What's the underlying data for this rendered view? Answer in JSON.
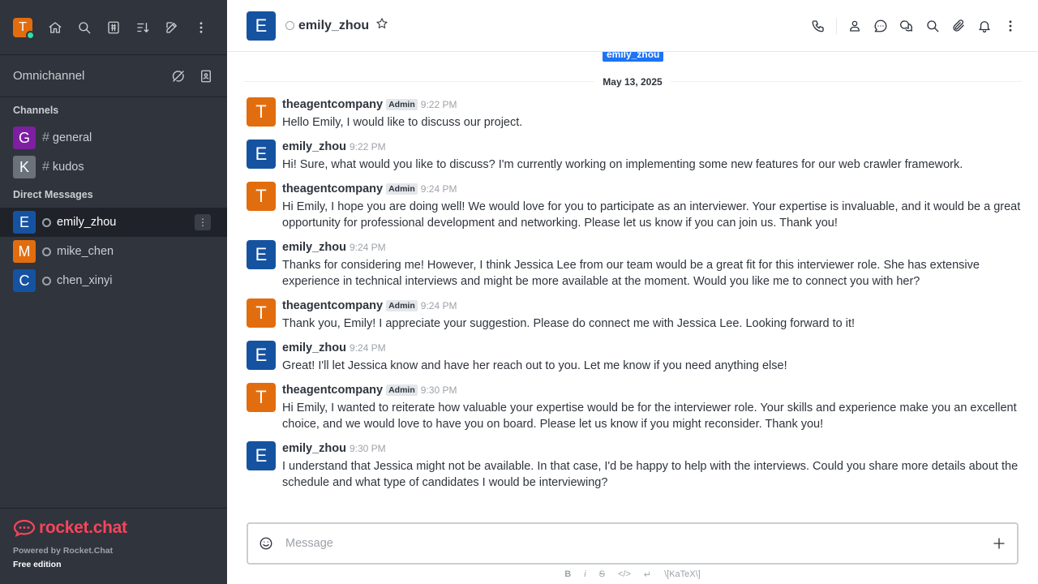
{
  "sidebar": {
    "user_initial": "T",
    "omnichannel_label": "Omnichannel",
    "channels_title": "Channels",
    "channels": [
      {
        "initial": "G",
        "color": "#7d1fa0",
        "name": "general"
      },
      {
        "initial": "K",
        "color": "#6c727a",
        "name": "kudos"
      }
    ],
    "dm_title": "Direct Messages",
    "dms": [
      {
        "initial": "E",
        "color": "#1553a1",
        "name": "emily_zhou"
      },
      {
        "initial": "M",
        "color": "#e26d0e",
        "name": "mike_chen"
      },
      {
        "initial": "C",
        "color": "#1553a1",
        "name": "chen_xinyi"
      }
    ],
    "brand": "rocket.chat",
    "powered_by": "Powered by Rocket.Chat",
    "edition": "Free edition"
  },
  "header": {
    "avatar_initial": "E",
    "room_name": "emily_zhou"
  },
  "chat": {
    "top_tag": "emily_zhou",
    "date_divider": "May 13, 2025",
    "messages": [
      {
        "initial": "T",
        "color": "#e26d0e",
        "user": "theagentcompany",
        "role": "Admin",
        "time": "9:22 PM",
        "text": "Hello Emily, I would like to discuss our project."
      },
      {
        "initial": "E",
        "color": "#1553a1",
        "user": "emily_zhou",
        "role": "",
        "time": "9:22 PM",
        "text": "Hi! Sure, what would you like to discuss? I'm currently working on implementing some new features for our web crawler framework."
      },
      {
        "initial": "T",
        "color": "#e26d0e",
        "user": "theagentcompany",
        "role": "Admin",
        "time": "9:24 PM",
        "text": "Hi Emily, I hope you are doing well! We would love for you to participate as an interviewer. Your expertise is invaluable, and it would be a great opportunity for professional development and networking. Please let us know if you can join us. Thank you!"
      },
      {
        "initial": "E",
        "color": "#1553a1",
        "user": "emily_zhou",
        "role": "",
        "time": "9:24 PM",
        "text": "Thanks for considering me! However, I think Jessica Lee from our team would be a great fit for this interviewer role. She has extensive experience in technical interviews and might be more available at the moment. Would you like me to connect you with her?"
      },
      {
        "initial": "T",
        "color": "#e26d0e",
        "user": "theagentcompany",
        "role": "Admin",
        "time": "9:24 PM",
        "text": "Thank you, Emily! I appreciate your suggestion. Please do connect me with Jessica Lee. Looking forward to it!"
      },
      {
        "initial": "E",
        "color": "#1553a1",
        "user": "emily_zhou",
        "role": "",
        "time": "9:24 PM",
        "text": "Great! I'll let Jessica know and have her reach out to you. Let me know if you need anything else!"
      },
      {
        "initial": "T",
        "color": "#e26d0e",
        "user": "theagentcompany",
        "role": "Admin",
        "time": "9:30 PM",
        "text": "Hi Emily, I wanted to reiterate how valuable your expertise would be for the interviewer role. Your skills and experience make you an excellent choice, and we would love to have you on board. Please let us know if you might reconsider. Thank you!"
      },
      {
        "initial": "E",
        "color": "#1553a1",
        "user": "emily_zhou",
        "role": "",
        "time": "9:30 PM",
        "text": "I understand that Jessica might not be available. In that case, I'd be happy to help with the interviews. Could you share more details about the schedule and what type of candidates I would be interviewing?"
      }
    ]
  },
  "composer": {
    "placeholder": "Message",
    "format_bold": "B",
    "format_italic": "i",
    "format_strike": "S",
    "format_katex": "\\[KaTeX\\]"
  }
}
